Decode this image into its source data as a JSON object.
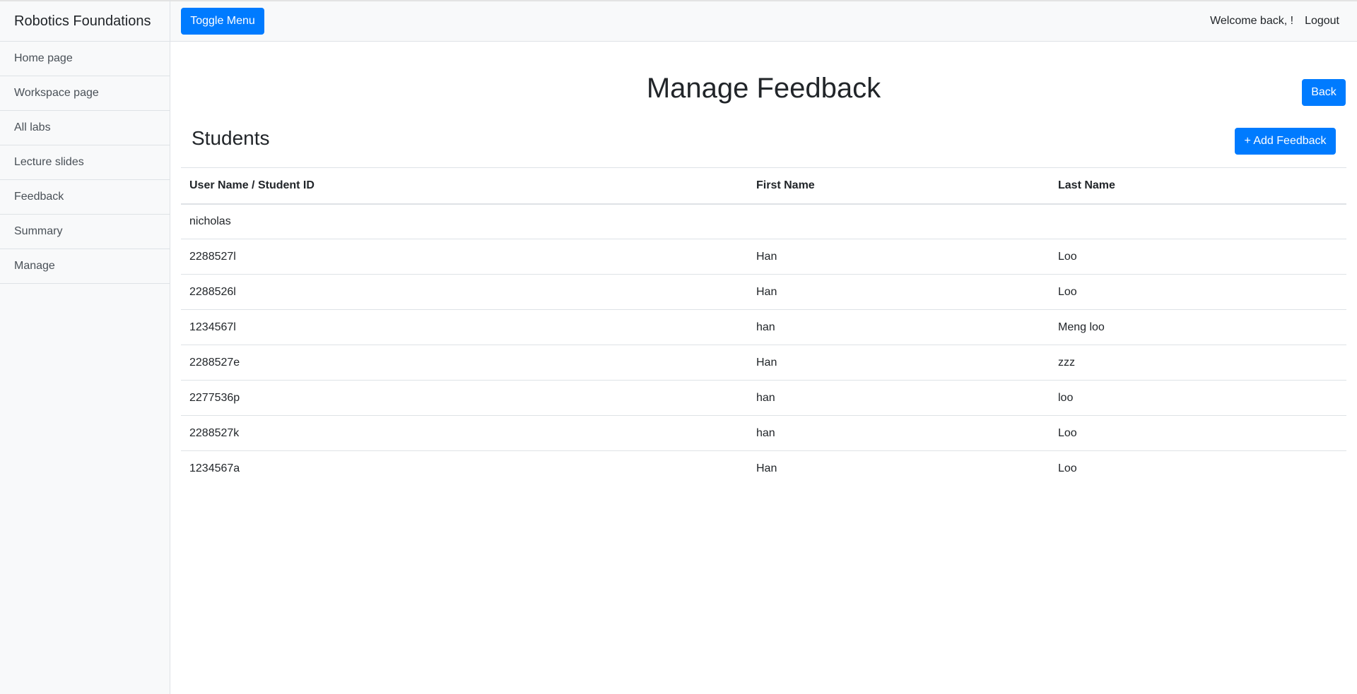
{
  "sidebar": {
    "heading": "Robotics Foundations",
    "items": [
      {
        "label": "Home page"
      },
      {
        "label": "Workspace page"
      },
      {
        "label": "All labs"
      },
      {
        "label": "Lecture slides"
      },
      {
        "label": "Feedback"
      },
      {
        "label": "Summary"
      },
      {
        "label": "Manage"
      }
    ]
  },
  "navbar": {
    "toggle_label": "Toggle Menu",
    "welcome_text": "Welcome back, !",
    "logout_label": "Logout"
  },
  "main": {
    "title": "Manage Feedback",
    "back_label": "Back",
    "section_title": "Students",
    "add_label": "+ Add Feedback",
    "table": {
      "headers": [
        "User Name / Student ID",
        "First Name",
        "Last Name"
      ],
      "rows": [
        [
          "nicholas",
          "",
          ""
        ],
        [
          "2288527l",
          "Han",
          "Loo"
        ],
        [
          "2288526l",
          "Han",
          "Loo"
        ],
        [
          "1234567l",
          "han",
          "Meng loo"
        ],
        [
          "2288527e",
          "Han",
          "zzz"
        ],
        [
          "2277536p",
          "han",
          "loo"
        ],
        [
          "2288527k",
          "han",
          "Loo"
        ],
        [
          "1234567a",
          "Han",
          "Loo"
        ]
      ]
    }
  },
  "colors": {
    "primary": "#007bff",
    "sidebar_bg": "#f8f9fa",
    "border": "#dee2e6",
    "text": "#212529"
  }
}
